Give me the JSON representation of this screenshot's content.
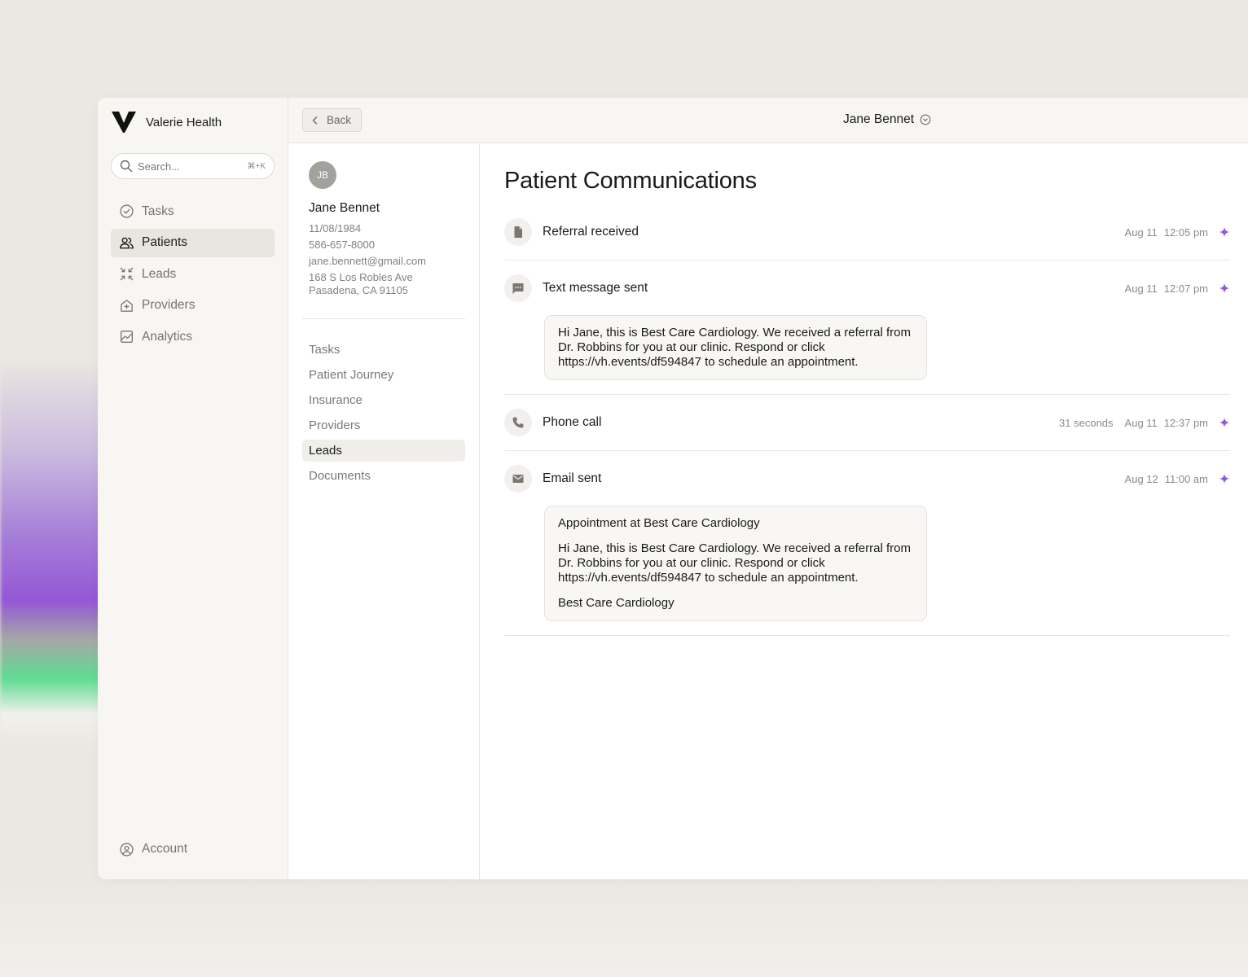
{
  "brand": {
    "name": "Valerie Health"
  },
  "search": {
    "placeholder": "Search...",
    "shortcut": "⌘+K"
  },
  "sidebar": {
    "items": [
      {
        "label": "Tasks",
        "icon": "check-circle-icon"
      },
      {
        "label": "Patients",
        "icon": "users-icon",
        "active": true
      },
      {
        "label": "Leads",
        "icon": "leads-icon"
      },
      {
        "label": "Providers",
        "icon": "providers-icon"
      },
      {
        "label": "Analytics",
        "icon": "analytics-icon"
      }
    ],
    "account_label": "Account"
  },
  "topbar": {
    "back_label": "Back",
    "patient_name": "Jane Bennet"
  },
  "patient": {
    "initials": "JB",
    "name": "Jane Bennet",
    "dob": "11/08/1984",
    "phone": "586-657-8000",
    "email": "jane.bennett@gmail.com",
    "address_line1": "168 S Los Robles Ave",
    "address_line2": "Pasadena, CA 91105"
  },
  "subnav": [
    {
      "label": "Tasks"
    },
    {
      "label": "Patient Journey"
    },
    {
      "label": "Insurance"
    },
    {
      "label": "Providers"
    },
    {
      "label": "Leads",
      "active": true
    },
    {
      "label": "Documents"
    }
  ],
  "comms": {
    "title": "Patient Communications",
    "items": [
      {
        "title": "Referral received",
        "date": "Aug 11",
        "time": "12:05 pm",
        "icon": "document-icon"
      },
      {
        "title": "Text message sent",
        "date": "Aug 11",
        "time": "12:07 pm",
        "icon": "message-icon",
        "body": "Hi Jane, this is Best Care Cardiology. We received a referral from Dr. Robbins for you at our clinic. Respond or click https://vh.events/df594847 to schedule an appointment."
      },
      {
        "title": "Phone call",
        "duration": "31 seconds",
        "date": "Aug 11",
        "time": "12:37 pm",
        "icon": "phone-icon"
      },
      {
        "title": "Email sent",
        "date": "Aug 12",
        "time": "11:00 am",
        "icon": "mail-icon",
        "subject": "Appointment at Best Care Cardiology",
        "body": "Hi Jane, this is Best Care Cardiology. We received a referral from Dr. Robbins for you at our clinic. Respond or click https://vh.events/df594847 to schedule an appointment.",
        "signature": "Best Care Cardiology"
      }
    ]
  },
  "colors": {
    "accent": "#8b5bd6",
    "sidebar_bg": "#f7f6f3",
    "active_bg": "#e8e6e1"
  }
}
